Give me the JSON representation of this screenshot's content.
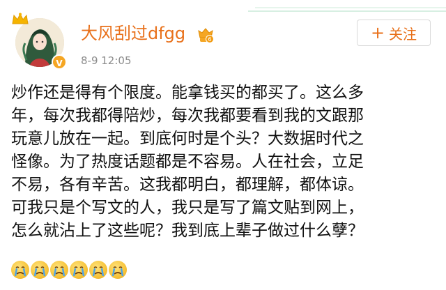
{
  "post": {
    "author": {
      "name": "大风刮过dfgg",
      "avatar_alt": "avatar",
      "vip_badge": "V",
      "level_badge": "6"
    },
    "timestamp": "8-9 12:05",
    "follow_button": {
      "icon": "plus-icon",
      "label": "关注"
    },
    "body_lines": [
      "炒作还是得有个限度。能拿钱买的都买了。这么多",
      "年，每次我都得陪炒，每次我都要看到我的文跟那",
      "玩意儿放在一起。到底何时是个头？大数据时代之",
      "怪像。为了热度话题都是不容易。人在社会，立足",
      "不易，各有辛苦。这我都明白，都理解，都体谅。",
      "可我只是个写文的人，我只是写了篇文贴到网上，",
      "怎么就沾上了这些呢？我到底上辈子做过什么孽？"
    ],
    "emojis": [
      "crying-face-icon",
      "crying-face-icon",
      "crying-face-icon",
      "crying-face-icon",
      "crying-face-icon",
      "crying-face-icon"
    ]
  },
  "colors": {
    "accent": "#e8701a",
    "timestamp": "#8c8c8c",
    "text": "#111111"
  }
}
